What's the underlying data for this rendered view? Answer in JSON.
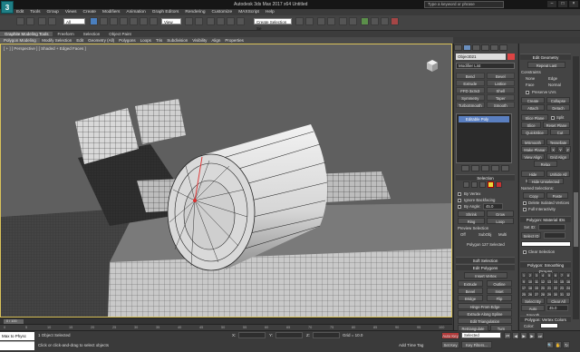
{
  "title": "Autodesk 3ds Max 2017 x64   Untitled",
  "search_placeholder": "Type a keyword or phrase",
  "logo_text": "3",
  "menu": [
    "Edit",
    "Tools",
    "Group",
    "Views",
    "Create",
    "Modifiers",
    "Animation",
    "Graph Editors",
    "Rendering",
    "Customize",
    "MAXScript",
    "Help"
  ],
  "toolbar": {
    "selection_filter": "All",
    "view_dropdown": "View",
    "selection_set": "Create Selection Se"
  },
  "ribbon_tabs": [
    "Graphite Modeling Tools",
    "Freeform",
    "Selection",
    "Object Paint"
  ],
  "ribbon_subtabs": [
    "Polygon Modeling",
    "Modify Selection",
    "Edit",
    "Geometry (All)",
    "Polygons",
    "Loops",
    "Tris",
    "Subdivision",
    "Visibility",
    "Align",
    "Properties"
  ],
  "viewport": {
    "label": "[ + ] [ Perspective ] [ Shaded + Edged Faces ]"
  },
  "timeline": {
    "position": "0 / 100",
    "ticks": [
      "0",
      "5",
      "10",
      "15",
      "20",
      "25",
      "30",
      "35",
      "40",
      "45",
      "50",
      "55",
      "60",
      "65",
      "70",
      "75",
      "80",
      "85",
      "90",
      "95",
      "100"
    ]
  },
  "status": {
    "maxscript": "Max to Physc",
    "selection": "1 Object Selected",
    "prompt": "Click or click-and-drag to select objects",
    "grid": "Grid = 10.0",
    "x_label": "X:",
    "y_label": "Y:",
    "z_label": "Z:",
    "add_time_tag": "Add Time Tag",
    "auto_key": "Auto Key",
    "set_key": "Set Key",
    "key_filters": "Key Filters...",
    "selected": "Selected"
  },
  "command_panel": {
    "object_name": "Object021",
    "modifier_list": "Modifier List",
    "modifiers": [
      "Bend",
      "Bevel",
      "Extrude",
      "Lattice",
      "FFD 3x3x3",
      "Shell",
      "Symmetry",
      "Taper",
      "TurboSmooth",
      "Smooth"
    ],
    "stack_item": "Editable Poly",
    "selection_header": "Selection",
    "by_vertex": "By Vertex",
    "ignore_backfacing": "Ignore Backfacing",
    "by_angle": "By Angle:",
    "by_angle_value": "45.0",
    "shrink": "Shrink",
    "grow": "Grow",
    "ring": "Ring",
    "loop": "Loop",
    "preview_selection": "Preview Selection",
    "preview_off": "Off",
    "preview_subobj": "SubObj",
    "preview_multi": "Multi",
    "selection_count": "Polygon 127 Selected",
    "soft_selection": "Soft Selection",
    "edit_polygons": "Edit Polygons",
    "insert_vertex": "Insert Vertex",
    "extrude": "Extrude",
    "outline": "Outline",
    "bevel": "Bevel",
    "inset": "Inset",
    "bridge": "Bridge",
    "flip": "Flip",
    "hinge": "Hinge From Edge",
    "extrude_spline": "Extrude Along Spline",
    "edit_triangulation": "Edit Triangulation",
    "retriangulate": "Retriangulate",
    "turn": "Turn"
  },
  "edit_geometry": {
    "header": "Edit Geometry",
    "repeat_last": "Repeat Last",
    "constraints": "Constraints",
    "none": "None",
    "edge": "Edge",
    "face": "Face",
    "normal": "Normal",
    "preserve_uvs": "Preserve UVs",
    "create": "Create",
    "collapse": "Collapse",
    "attach": "Attach",
    "detach": "Detach",
    "slice_plane": "Slice Plane",
    "split": "Split",
    "slice": "Slice",
    "reset_plane": "Reset Plane",
    "quickslice": "QuickSlice",
    "cut": "Cut",
    "msmooth": "MSmooth",
    "tessellate": "Tessellate",
    "make_planar": "Make Planar",
    "x": "X",
    "y": "Y",
    "z": "Z",
    "view_align": "View Align",
    "grid_align": "Grid Align",
    "relax": "Relax",
    "hide_selected": "Hide Selected",
    "unhide_all": "Unhide All",
    "hide_unselected": "Hide Unselected",
    "named_selections": "Named Selections:",
    "copy": "Copy",
    "paste": "Paste",
    "delete_isolated": "Delete Isolated Vertices",
    "full_interactivity": "Full Interactivity",
    "material_ids": "Polygon: Material IDs",
    "set_id": "Set ID:",
    "select_id": "Select ID",
    "clear_selection": "Clear Selection",
    "smoothing_groups": "Polygon: Smoothing Groups",
    "sg": [
      "1",
      "2",
      "3",
      "4",
      "5",
      "6",
      "7",
      "8",
      "9",
      "10",
      "11",
      "12",
      "13",
      "14",
      "15",
      "16",
      "17",
      "18",
      "19",
      "20",
      "21",
      "22",
      "23",
      "24",
      "25",
      "26",
      "27",
      "28",
      "29",
      "30",
      "31",
      "32"
    ],
    "select_by_sg": "Select By SG",
    "clear_all": "Clear All",
    "auto_smooth": "Auto Smooth",
    "auto_smooth_value": "45.0",
    "vertex_colors": "Polygon: Vertex Colors",
    "color": "Color:"
  }
}
